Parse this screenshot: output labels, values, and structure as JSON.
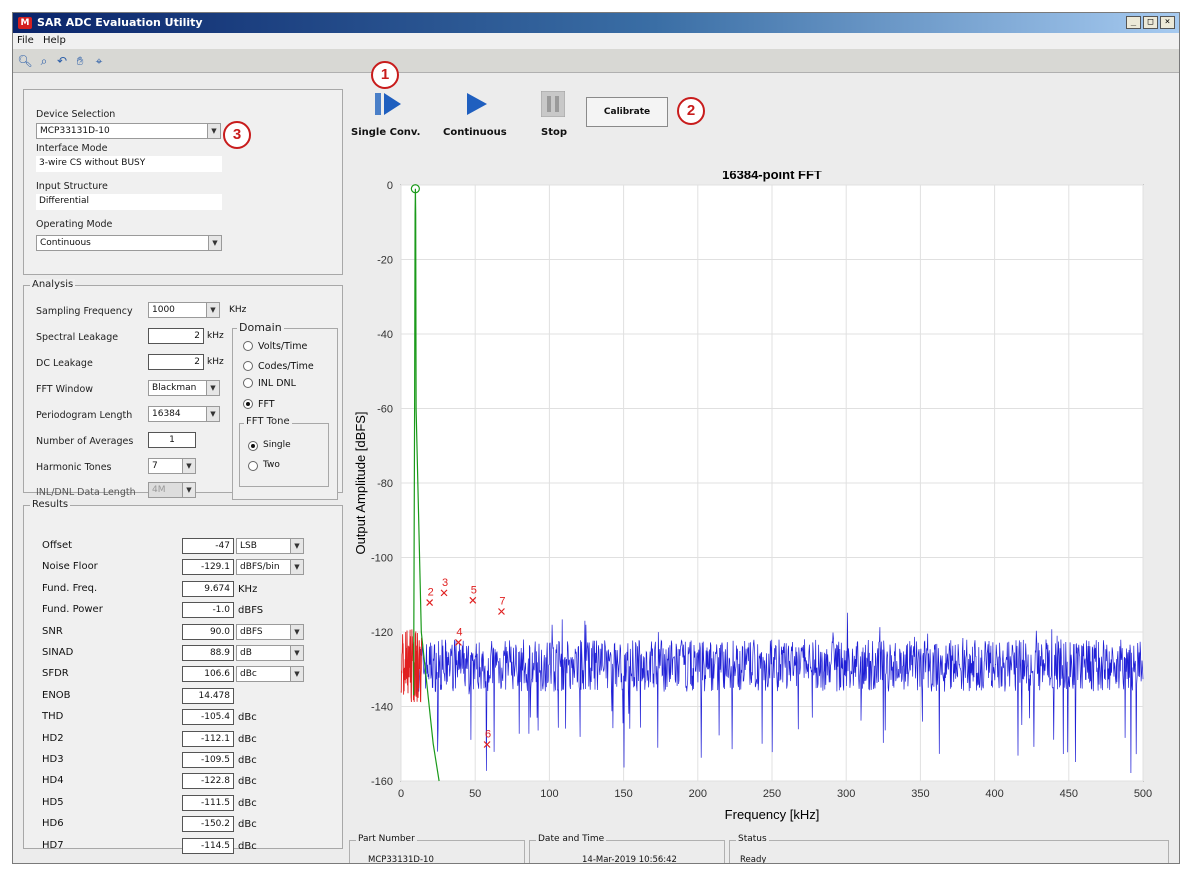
{
  "window": {
    "title": "SAR ADC Evaluation Utility",
    "logo": "M",
    "controls": [
      "_",
      "□",
      "×"
    ]
  },
  "menu": [
    "File",
    "Help"
  ],
  "toolbar": {
    "icons": [
      "zoom-in-icon",
      "zoom-out-icon",
      "zoom-reset-icon",
      "pan-hand-icon",
      "data-cursor-icon"
    ]
  },
  "callouts": [
    "1",
    "2",
    "3"
  ],
  "actions": {
    "single": "Single Conv.",
    "continuous": "Continuous",
    "stop": "Stop",
    "calibrate": "Calibrate"
  },
  "device": {
    "selection_label": "Device Selection",
    "selection_value": "MCP33131D-10",
    "interface_label": "Interface Mode",
    "interface_value": "3-wire CS without BUSY",
    "input_label": "Input Structure",
    "input_value": "Differential",
    "operating_label": "Operating Mode",
    "operating_value": "Continuous"
  },
  "analysis": {
    "title": "Analysis",
    "sampling_label": "Sampling Frequency",
    "sampling_value": "1000",
    "sampling_unit": "KHz",
    "spectral_label": "Spectral Leakage",
    "spectral_value": "2",
    "spectral_unit": "kHz",
    "dc_label": "DC Leakage",
    "dc_value": "2",
    "dc_unit": "kHz",
    "fftwin_label": "FFT Window",
    "fftwin_value": "Blackman",
    "period_label": "Periodogram Length",
    "period_value": "16384",
    "avg_label": "Number of Averages",
    "avg_value": "1",
    "harm_label": "Harmonic Tones",
    "harm_value": "7",
    "inl_label": "INL/DNL Data Length",
    "inl_value": "4M",
    "domain_title": "Domain",
    "domain_options": [
      "Volts/Time",
      "Codes/Time",
      "INL DNL",
      "FFT"
    ],
    "tone_title": "FFT Tone",
    "tone_options": [
      "Single",
      "Two"
    ]
  },
  "results": {
    "title": "Results",
    "rows": [
      {
        "label": "Offset",
        "value": "-47",
        "unit": "LSB"
      },
      {
        "label": "Noise Floor",
        "value": "-129.1",
        "unit": "dBFS/bin"
      },
      {
        "label": "Fund. Freq.",
        "value": "9.674",
        "unit": "KHz"
      },
      {
        "label": "Fund. Power",
        "value": "-1.0",
        "unit": "dBFS"
      },
      {
        "label": "SNR",
        "value": "90.0",
        "unit": "dBFS"
      },
      {
        "label": "SINAD",
        "value": "88.9",
        "unit": "dB"
      },
      {
        "label": "SFDR",
        "value": "106.6",
        "unit": "dBc"
      },
      {
        "label": "ENOB",
        "value": "14.478",
        "unit": ""
      },
      {
        "label": "THD",
        "value": "-105.4",
        "unit": "dBc"
      },
      {
        "label": "HD2",
        "value": "-112.1",
        "unit": "dBc"
      },
      {
        "label": "HD3",
        "value": "-109.5",
        "unit": "dBc"
      },
      {
        "label": "HD4",
        "value": "-122.8",
        "unit": "dBc"
      },
      {
        "label": "HD5",
        "value": "-111.5",
        "unit": "dBc"
      },
      {
        "label": "HD6",
        "value": "-150.2",
        "unit": "dBc"
      },
      {
        "label": "HD7",
        "value": "-114.5",
        "unit": "dBc"
      }
    ]
  },
  "status": {
    "part_label": "Part Number",
    "part_value": "MCP33131D-10",
    "date_label": "Date and Time",
    "date_value": "14-Mar-2019 10:56:42",
    "status_label": "Status",
    "status_value": "Ready"
  },
  "colors": {
    "noise": "#1f1fd6",
    "harmonic": "#e02020",
    "window": "#1a9a1a",
    "callout": "#c81c1c"
  },
  "chart_data": {
    "type": "line",
    "title": "16384-point FFT",
    "xlabel": "Frequency [kHz]",
    "ylabel": "Output Amplitude [dBFS]",
    "xlim": [
      0,
      500
    ],
    "ylim": [
      -160,
      0
    ],
    "xticks": [
      0,
      50,
      100,
      150,
      200,
      250,
      300,
      350,
      400,
      450,
      500
    ],
    "yticks": [
      0,
      -20,
      -40,
      -60,
      -80,
      -100,
      -120,
      -140,
      -160
    ],
    "grid": true,
    "noise_floor_db": -129,
    "fundamental": {
      "x": 9.674,
      "y": -1.0
    },
    "harmonics": [
      {
        "label": "2",
        "x": 19.3,
        "y": -112.1
      },
      {
        "label": "3",
        "x": 29.0,
        "y": -109.5
      },
      {
        "label": "4",
        "x": 38.7,
        "y": -122.8
      },
      {
        "label": "5",
        "x": 48.4,
        "y": -111.5
      },
      {
        "label": "6",
        "x": 58.0,
        "y": -150.2
      },
      {
        "label": "7",
        "x": 67.7,
        "y": -114.5
      }
    ]
  }
}
